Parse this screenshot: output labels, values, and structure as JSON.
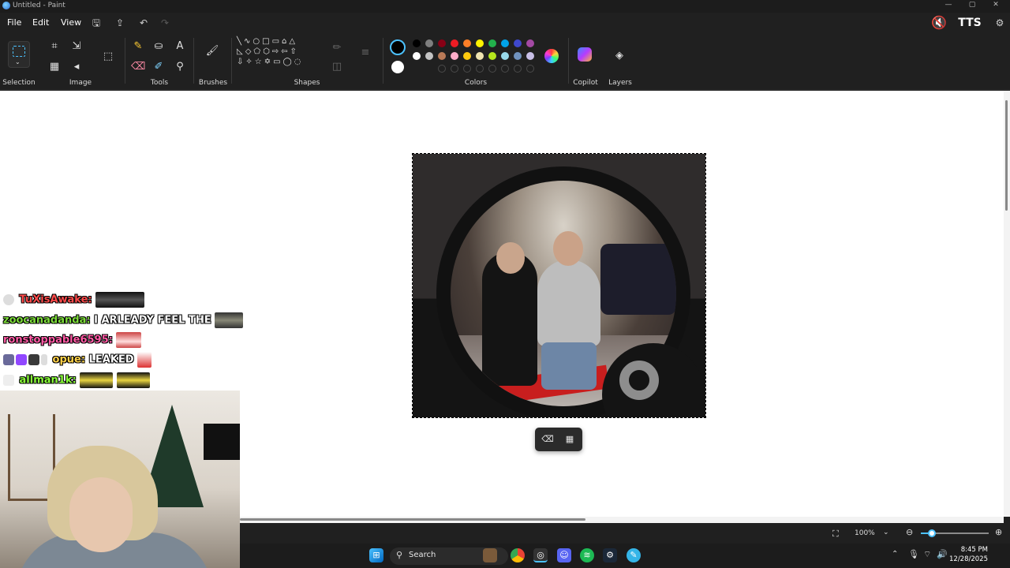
{
  "window": {
    "title": "Untitled - Paint"
  },
  "menubar": {
    "file": "File",
    "edit": "Edit",
    "view": "View"
  },
  "overlay_brand": "TTS",
  "ribbon": {
    "groups": {
      "selection": "Selection",
      "image": "Image",
      "tools": "Tools",
      "brushes": "Brushes",
      "shapes": "Shapes",
      "colors": "Colors",
      "copilot": "Copilot",
      "layers": "Layers"
    },
    "current_colors": {
      "primary": "#000000",
      "secondary": "#ffffff"
    },
    "palette_row1": [
      "#000000",
      "#7f7f7f",
      "#880015",
      "#ed1c24",
      "#ff7f27",
      "#fff200",
      "#22b14c",
      "#00a2e8",
      "#3f48cc",
      "#a349a4"
    ],
    "palette_row2": [
      "#ffffff",
      "#c3c3c3",
      "#b97a57",
      "#ffaec9",
      "#ffc90e",
      "#efe4b0",
      "#b5e61d",
      "#99d9ea",
      "#7092be",
      "#c8bfe7"
    ]
  },
  "status": {
    "zoom": "100%"
  },
  "taskbar": {
    "search_label": "Search",
    "time": "8:45 PM",
    "date": "12/28/2025"
  },
  "chat": [
    {
      "user": "TuXisAwake:",
      "color": "#ff4b4b",
      "text": ""
    },
    {
      "user": "zoocanadanda:",
      "color": "#7cdb3a",
      "text": "I ARLEADY FEEL THE"
    },
    {
      "user": "ronstoppable6595:",
      "color": "#ff5aa5",
      "text": ""
    },
    {
      "user": "opue:",
      "color": "#ffd24a",
      "text": "LEAKED"
    },
    {
      "user": "allman1k:",
      "color": "#8aff3a",
      "text": ""
    }
  ]
}
